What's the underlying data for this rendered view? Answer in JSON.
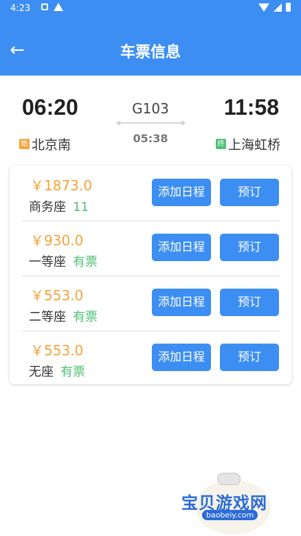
{
  "status_bar": {
    "time": "4:23"
  },
  "appbar": {
    "title": "车票信息",
    "back_icon": "←"
  },
  "trip": {
    "train_no": "G103",
    "depart_time": "06:20",
    "arrive_time": "11:58",
    "duration": "05:38",
    "depart_tag": "始",
    "arrive_tag": "终",
    "depart_station": "北京南",
    "arrive_station": "上海虹桥"
  },
  "seats": [
    {
      "price": "￥1873.0",
      "name": "商务座",
      "availability": "11"
    },
    {
      "price": "￥930.0",
      "name": "一等座",
      "availability": "有票"
    },
    {
      "price": "￥553.0",
      "name": "二等座",
      "availability": "有票"
    },
    {
      "price": "￥553.0",
      "name": "无座",
      "availability": "有票"
    }
  ],
  "buttons": {
    "add_schedule": "添加日程",
    "book": "预订"
  },
  "watermark": {
    "name": "宝贝游戏网",
    "url": "baobeiy.com"
  },
  "colors": {
    "primary": "#3d8ef2",
    "price": "#f5a33c",
    "available": "#4fc174"
  }
}
